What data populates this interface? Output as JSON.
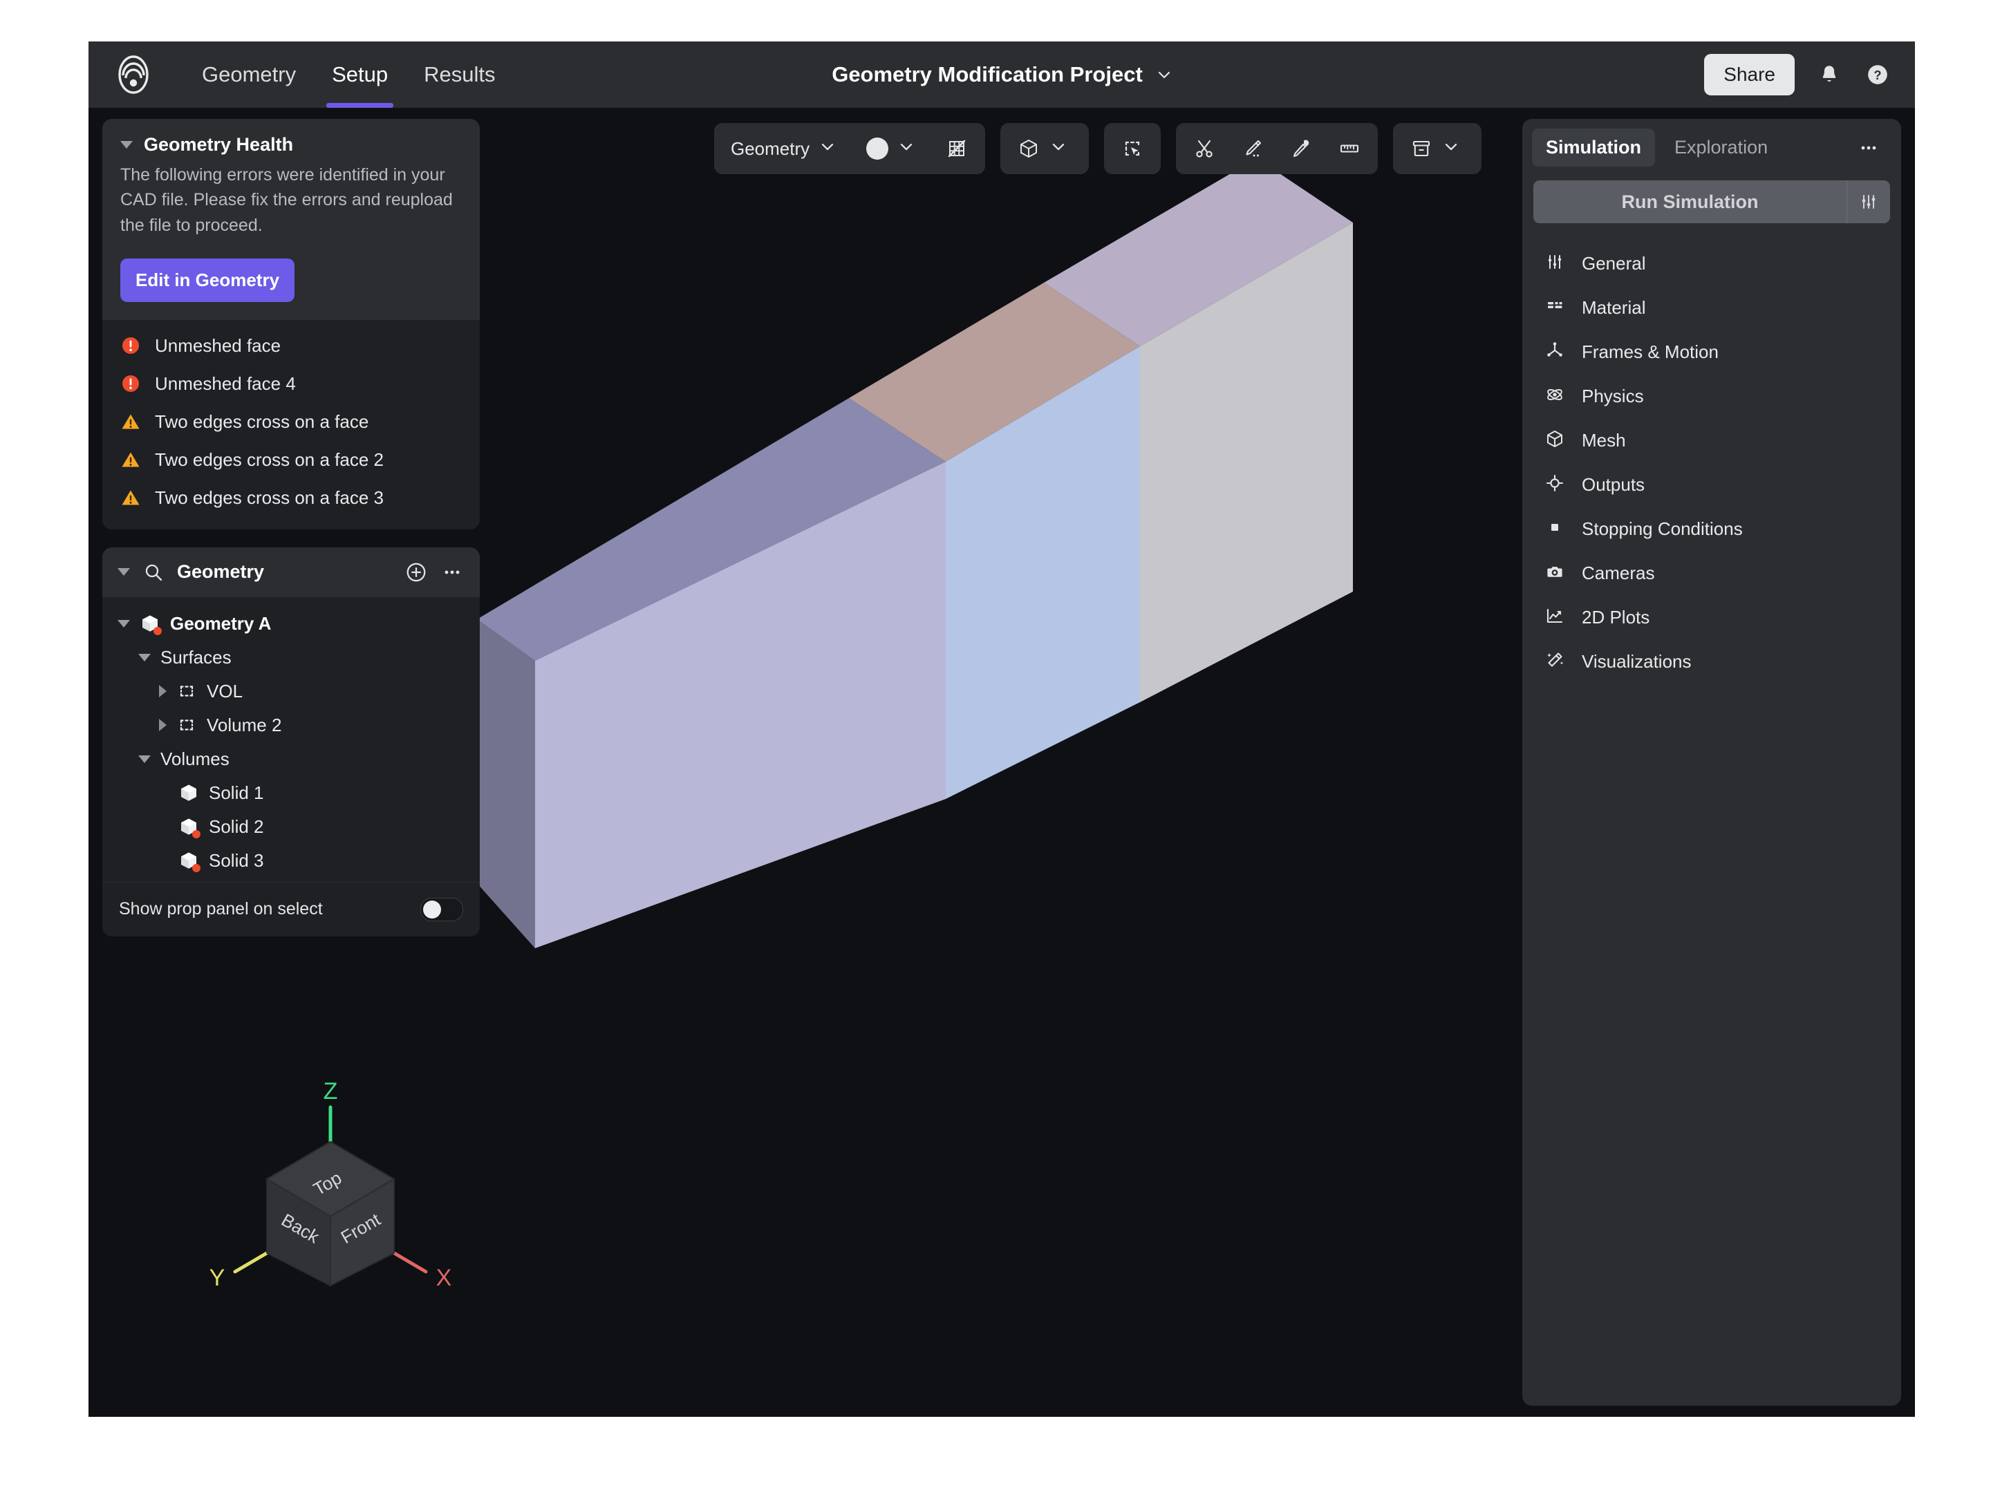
{
  "header": {
    "logo_icon": "app-logo",
    "tabs": [
      {
        "label": "Geometry",
        "active": false
      },
      {
        "label": "Setup",
        "active": true
      },
      {
        "label": "Results",
        "active": false
      }
    ],
    "project_title": "Geometry Modification Project",
    "title_chevron_icon": "chevron-down-icon",
    "share_label": "Share",
    "notifications_icon": "bell-icon",
    "help_icon": "help-circle-icon"
  },
  "geometry_health": {
    "title": "Geometry Health",
    "collapse_icon": "caret-down-icon",
    "description": "The following errors were identified in your CAD file. Please fix the errors and reupload the file to proceed.",
    "action_label": "Edit in Geometry",
    "issues": [
      {
        "label": "Unmeshed face",
        "severity": "error"
      },
      {
        "label": "Unmeshed face 4",
        "severity": "error"
      },
      {
        "label": "Two edges cross on a face",
        "severity": "warning"
      },
      {
        "label": "Two edges cross on a face 2",
        "severity": "warning"
      },
      {
        "label": "Two edges cross on a face 3",
        "severity": "warning"
      }
    ]
  },
  "geometry_tree": {
    "header_label": "Geometry",
    "search_icon": "search-icon",
    "add_icon": "plus-circle-icon",
    "more_icon": "ellipsis-icon",
    "nodes": [
      {
        "label": "Geometry A",
        "icon": "cube-icon",
        "depth": 0,
        "caret": "down",
        "bold": true,
        "error": true
      },
      {
        "label": "Surfaces",
        "icon": "",
        "depth": 1,
        "caret": "down",
        "bold": false,
        "error": false
      },
      {
        "label": "VOL",
        "icon": "surface-icon",
        "depth": 2,
        "caret": "right",
        "bold": false,
        "error": false
      },
      {
        "label": "Volume 2",
        "icon": "surface-icon",
        "depth": 2,
        "caret": "right",
        "bold": false,
        "error": false
      },
      {
        "label": "Volumes",
        "icon": "",
        "depth": 1,
        "caret": "down",
        "bold": false,
        "error": false
      },
      {
        "label": "Solid 1",
        "icon": "cube-icon",
        "depth": 2,
        "caret": "none",
        "bold": false,
        "error": false
      },
      {
        "label": "Solid 2",
        "icon": "cube-icon",
        "depth": 2,
        "caret": "none",
        "bold": false,
        "error": true
      },
      {
        "label": "Solid 3",
        "icon": "cube-icon",
        "depth": 2,
        "caret": "none",
        "bold": false,
        "error": true
      }
    ],
    "toggle_label": "Show prop panel on select",
    "toggle_on": false
  },
  "toolbar": {
    "groups": [
      {
        "items": [
          {
            "type": "text",
            "label": "Geometry",
            "icon": "chevron-down-icon",
            "name": "geometry-mode-dropdown"
          },
          {
            "type": "swatch",
            "label": "",
            "icon": "chevron-down-icon",
            "name": "display-style-dropdown"
          },
          {
            "type": "icon",
            "label": "",
            "icon": "mesh-off-icon",
            "name": "mesh-visibility-toggle"
          }
        ]
      },
      {
        "items": [
          {
            "type": "icon",
            "label": "",
            "icon": "cube-icon",
            "name": "selection-type-dropdown",
            "chevron": true
          }
        ]
      },
      {
        "items": [
          {
            "type": "icon",
            "label": "",
            "icon": "box-select-icon",
            "name": "box-select-tool"
          }
        ]
      },
      {
        "items": [
          {
            "type": "icon",
            "label": "",
            "icon": "scissors-icon",
            "name": "cut-tool"
          },
          {
            "type": "icon",
            "label": "",
            "icon": "knife-icon",
            "name": "knife-tool"
          },
          {
            "type": "icon",
            "label": "",
            "icon": "eyedropper-icon",
            "name": "eyedropper-tool"
          },
          {
            "type": "icon",
            "label": "",
            "icon": "ruler-icon",
            "name": "measure-tool"
          }
        ]
      },
      {
        "items": [
          {
            "type": "icon",
            "label": "",
            "icon": "archive-box-icon",
            "name": "clip-plane-dropdown",
            "chevron": true
          }
        ]
      }
    ]
  },
  "right_panel": {
    "tabs": [
      {
        "label": "Simulation",
        "active": true
      },
      {
        "label": "Exploration",
        "active": false
      }
    ],
    "more_icon": "ellipsis-icon",
    "run_label": "Run Simulation",
    "run_settings_icon": "sliders-icon",
    "items": [
      {
        "label": "General",
        "icon": "sliders-icon"
      },
      {
        "label": "Material",
        "icon": "grid-icon"
      },
      {
        "label": "Frames & Motion",
        "icon": "axes-icon"
      },
      {
        "label": "Physics",
        "icon": "atom-icon"
      },
      {
        "label": "Mesh",
        "icon": "cube-icon"
      },
      {
        "label": "Outputs",
        "icon": "crosshair-icon"
      },
      {
        "label": "Stopping Conditions",
        "icon": "stop-square-icon"
      },
      {
        "label": "Cameras",
        "icon": "camera-icon"
      },
      {
        "label": "2D Plots",
        "icon": "line-chart-icon"
      },
      {
        "label": "Visualizations",
        "icon": "magic-wand-icon"
      }
    ]
  },
  "nav_cube": {
    "faces": {
      "top": "Top",
      "left": "Back",
      "right": "Front"
    },
    "axes": {
      "z": "Z",
      "y": "Y",
      "x": "X"
    },
    "axis_colors": {
      "z": "#3ddc84",
      "y": "#e2e06a",
      "x": "#e06666"
    }
  },
  "model": {
    "name": "Geometry A",
    "segments": [
      {
        "name": "Solid 1",
        "top_color": "#8a89b0",
        "front_color": "#b9b7d8",
        "end_color": "#74738f"
      },
      {
        "name": "Solid 2",
        "top_color": "#b89f9b",
        "front_color": "#b5c5e6",
        "end_color": "#b89f9b"
      },
      {
        "name": "Solid 3",
        "top_color": "#b8aec6",
        "front_color": "#c6c6cb",
        "end_color": "#b8aec6"
      }
    ]
  },
  "colors": {
    "accent": "#6c5ce7",
    "error": "#ef4b2c",
    "warning": "#f5a623",
    "panel": "#2b2d31",
    "panel_dark": "#1e2024",
    "viewport": "#0e1013"
  }
}
